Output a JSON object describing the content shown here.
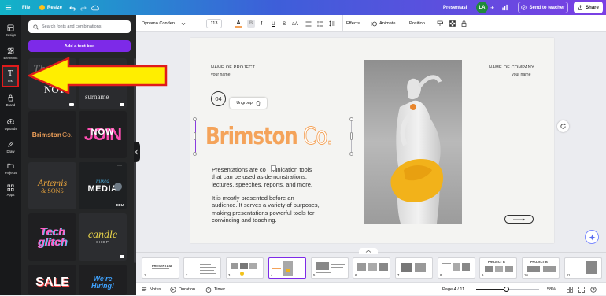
{
  "topbar": {
    "file": "File",
    "resize": "Resize",
    "doc_title": "Presentasi",
    "avatar_initials": "LA",
    "send_to_teacher": "Send to teacher",
    "share": "Share"
  },
  "rail": {
    "items": [
      {
        "label": "Design",
        "icon": "design-icon"
      },
      {
        "label": "Elements",
        "icon": "elements-icon"
      },
      {
        "label": "Text",
        "icon": "text-icon"
      },
      {
        "label": "Brand",
        "icon": "brand-icon"
      },
      {
        "label": "Uploads",
        "icon": "upload-icon"
      },
      {
        "label": "Draw",
        "icon": "draw-icon"
      },
      {
        "label": "Projects",
        "icon": "folder-icon"
      },
      {
        "label": "Apps",
        "icon": "apps-icon"
      }
    ]
  },
  "panel": {
    "search_placeholder": "Search fonts and combinations",
    "add_text_box": "Add a text box",
    "tiles": [
      {
        "line1": "NOT"
      },
      {
        "line1": "surname"
      },
      {
        "line1": "Brimston",
        "line2": "Co."
      },
      {
        "line1": "JOIN",
        "line2": "NOW"
      },
      {
        "line1": "Artemis",
        "line2": "& SONS"
      },
      {
        "line1": "mixed",
        "line2": "MEDIA",
        "badge": "EDU"
      },
      {
        "line1": "Tech",
        "line2": "glitch"
      },
      {
        "line1": "candle",
        "line2": "SHOP"
      },
      {
        "line1": "SALE"
      },
      {
        "line1": "We're",
        "line2": "Hiring!"
      }
    ]
  },
  "toolbar": {
    "font_name": "Dynamo Conden...",
    "font_size": "113",
    "minus": "−",
    "plus": "+",
    "effects": "Effects",
    "animate": "Animate",
    "position": "Position"
  },
  "slide": {
    "name_of_project": "NAME OF PROJECT",
    "your_name_left": "your name",
    "name_of_company": "NAME OF COMPANY",
    "your_name_right": "your name",
    "slide_number": "04",
    "ungroup": "Ungroup",
    "brand_word": "Brimston",
    "brand_co": "Co.",
    "para1_line1": "Presentations are co   nunication tools",
    "para1_line2": "that can be used as demonstrations,",
    "para1_line3": "lectures, speeches, reports, and more.",
    "para2_line1": "It is mostly presented before an",
    "para2_line2": "audience. It serves a variety of purposes,",
    "para2_line3": "making presentations powerful tools for",
    "para2_line4": "convincing and teaching."
  },
  "filmstrip": {
    "thumbs": [
      {
        "num": "1",
        "title": "PRESENTASI"
      },
      {
        "num": "2",
        "title": ""
      },
      {
        "num": "3",
        "title": ""
      },
      {
        "num": "4",
        "title": ""
      },
      {
        "num": "5",
        "title": ""
      },
      {
        "num": "6",
        "title": ""
      },
      {
        "num": "7",
        "title": ""
      },
      {
        "num": "8",
        "title": ""
      },
      {
        "num": "9",
        "title": "PROJECT B"
      },
      {
        "num": "10",
        "title": "PROJECT B"
      },
      {
        "num": "11",
        "title": ""
      }
    ]
  },
  "bottombar": {
    "notes": "Notes",
    "duration": "Duration",
    "timer": "Timer",
    "page_indicator": "Page 4 / 11",
    "zoom": "58%",
    "zoom_fraction": 0.58
  },
  "colors": {
    "accent": "#7d2ae8",
    "brand_orange": "#f4a35a",
    "arrow_yellow": "#ffee00",
    "arrow_red": "#e01b1b"
  }
}
